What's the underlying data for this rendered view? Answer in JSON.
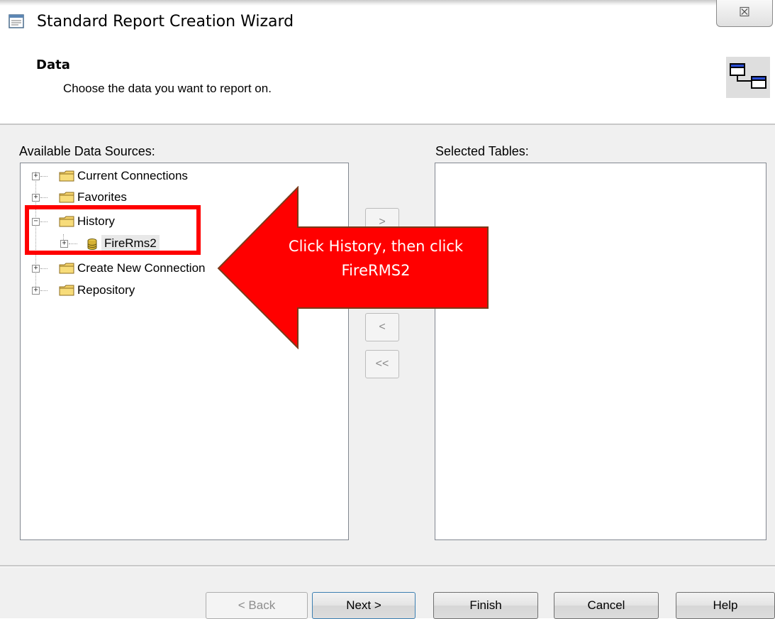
{
  "window": {
    "title": "Standard Report Creation Wizard",
    "close_glyph": "☒"
  },
  "header": {
    "title": "Data",
    "subtitle": "Choose the data you want to report on.",
    "icon": "linked-tables-icon"
  },
  "available": {
    "label": "Available Data Sources:",
    "tree": [
      {
        "label": "Current Connections",
        "expander": "+",
        "icon": "folder-icon"
      },
      {
        "label": "Favorites",
        "expander": "+",
        "icon": "folder-icon"
      },
      {
        "label": "History",
        "expander": "−",
        "icon": "folder-icon",
        "expanded": true
      },
      {
        "label": "FireRms2",
        "expander": "+",
        "icon": "database-icon",
        "child": true,
        "selected": true
      },
      {
        "label": "Create New Connection",
        "expander": "+",
        "icon": "folder-icon"
      },
      {
        "label": "Repository",
        "expander": "+",
        "icon": "folder-icon"
      }
    ]
  },
  "selected": {
    "label": "Selected Tables:"
  },
  "transfer": {
    "add": ">",
    "add_all": ">>",
    "remove": "<",
    "remove_all": "<<"
  },
  "footer": {
    "back": "< Back",
    "next": "Next >",
    "finish": "Finish",
    "cancel": "Cancel",
    "help": "Help"
  },
  "annotation": {
    "line1": "Click History, then click",
    "line2": "FireRMS2",
    "arrow_color": "#ff0000",
    "border_color": "#7a3a1a"
  }
}
